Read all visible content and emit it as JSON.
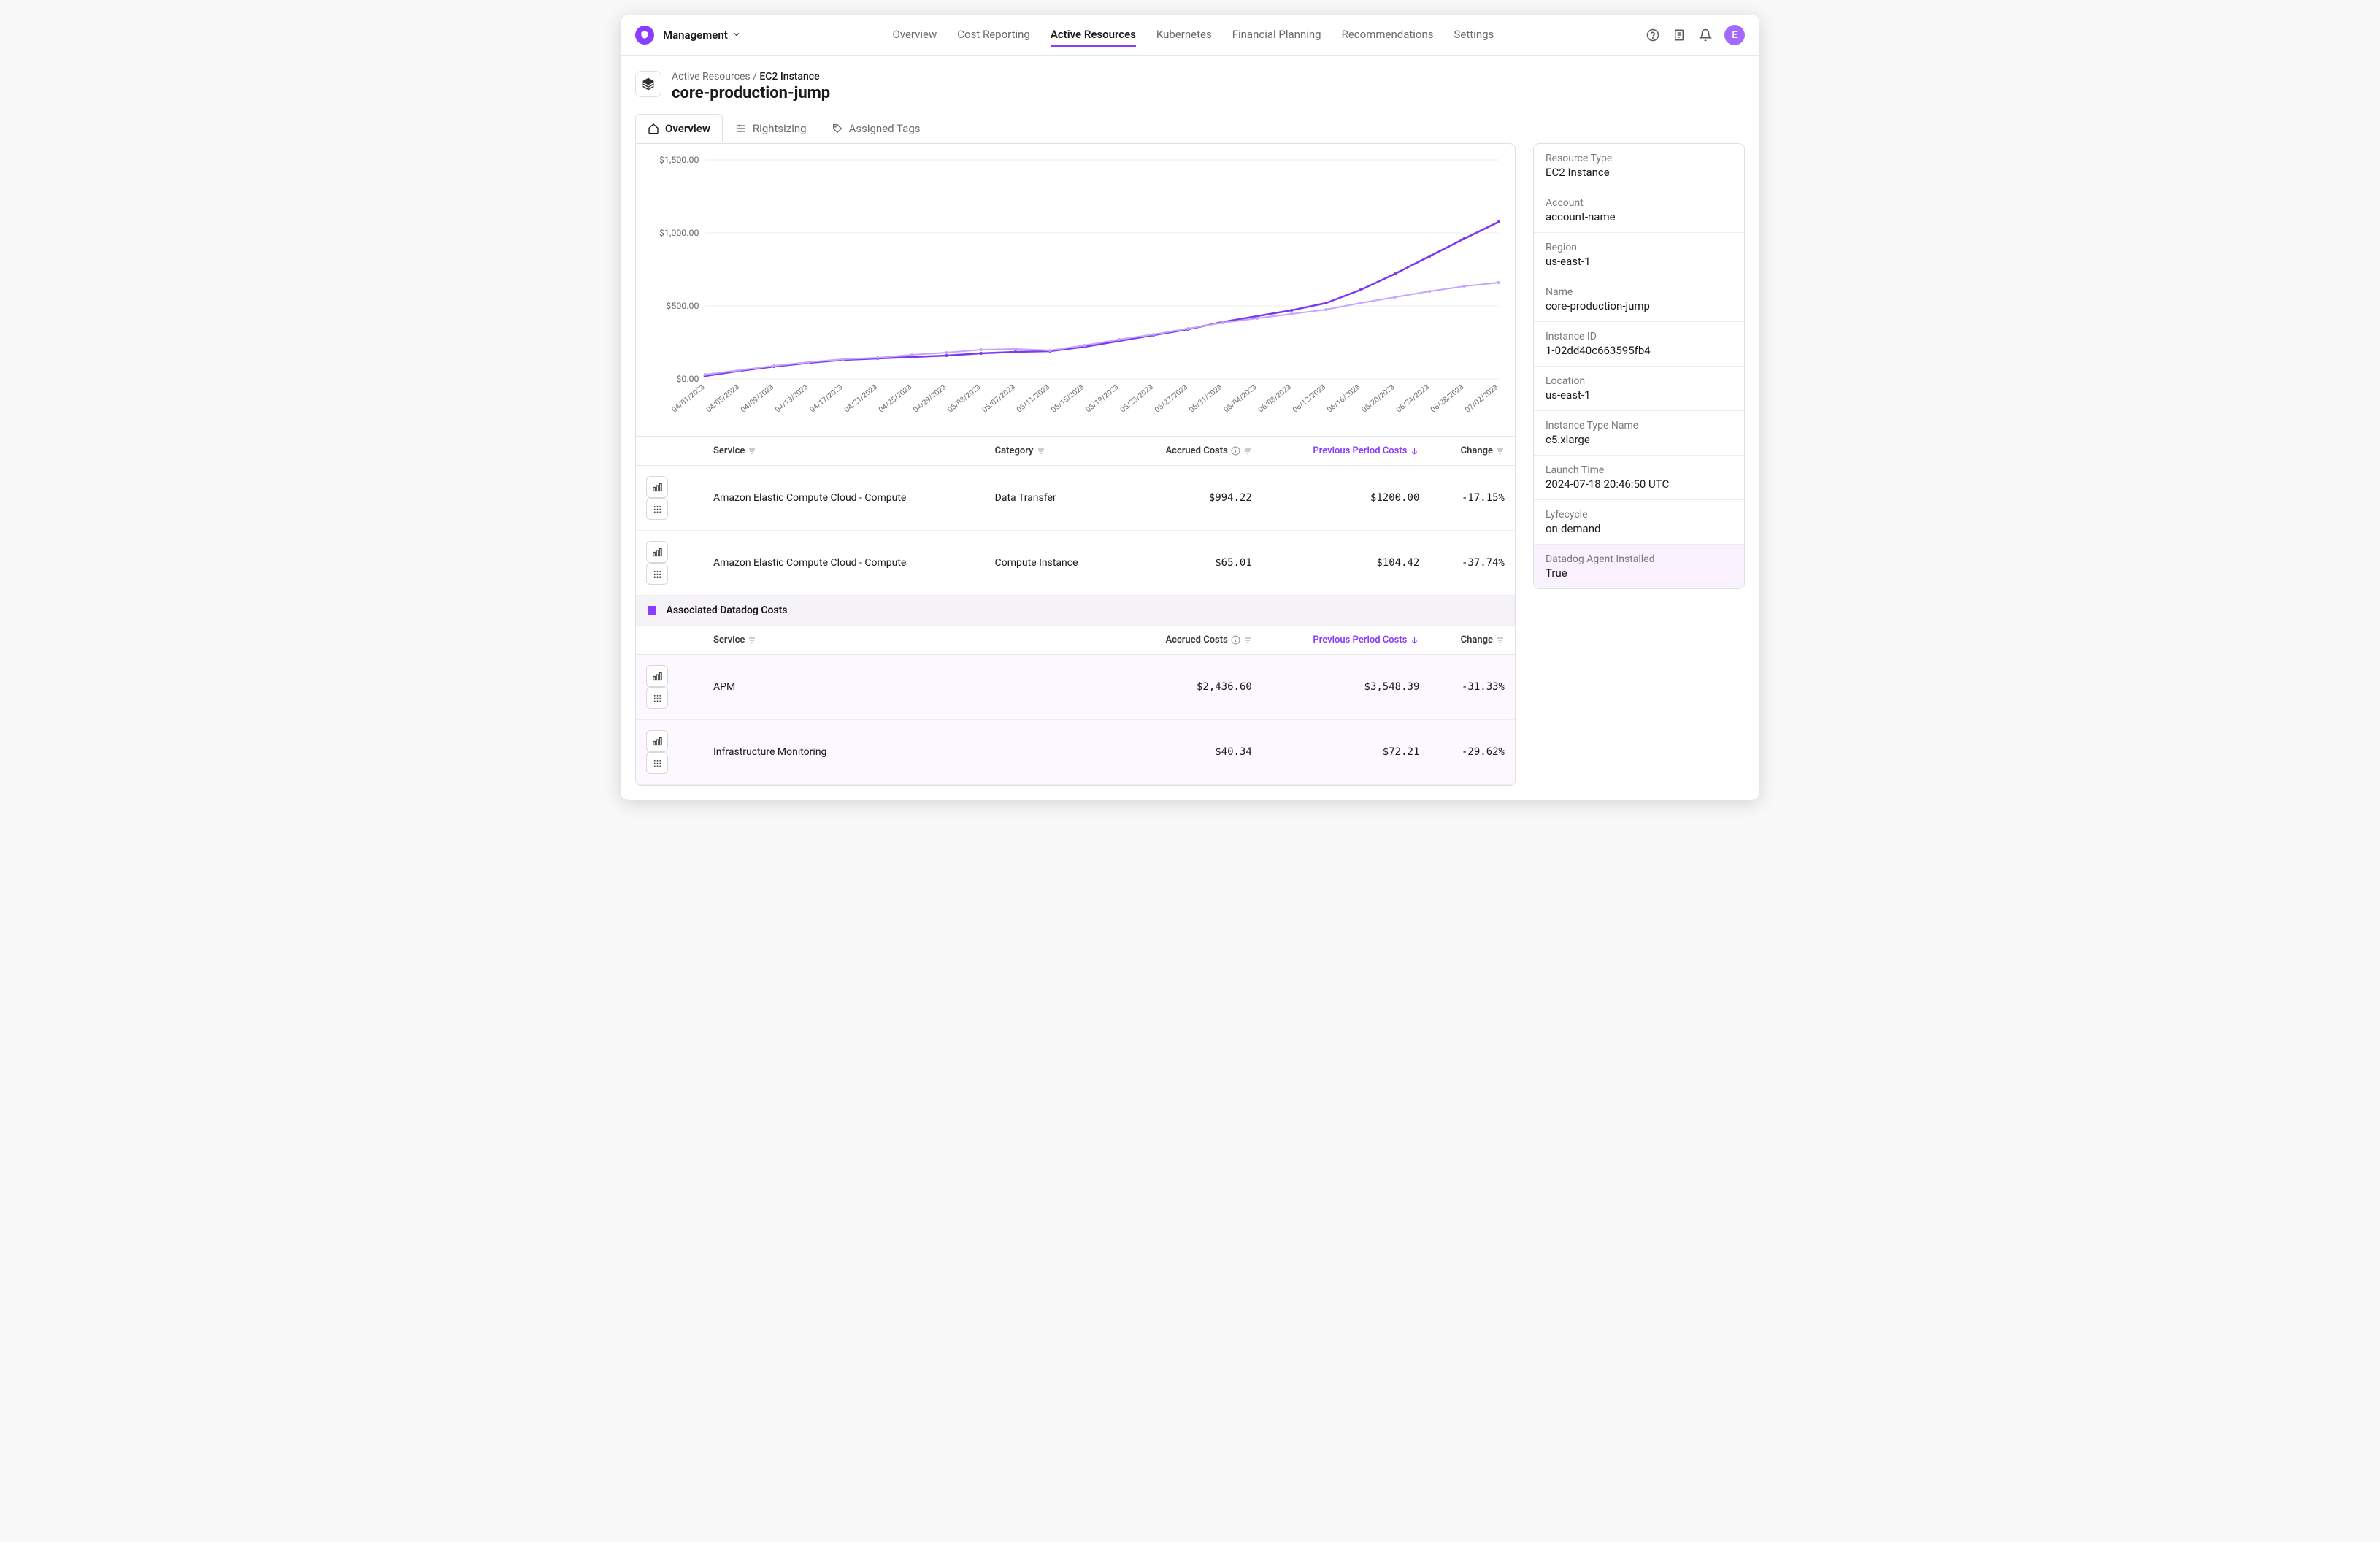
{
  "workspace": "Management",
  "avatar_initial": "E",
  "nav": [
    {
      "label": "Overview",
      "active": false
    },
    {
      "label": "Cost Reporting",
      "active": false
    },
    {
      "label": "Active Resources",
      "active": true
    },
    {
      "label": "Kubernetes",
      "active": false
    },
    {
      "label": "Financial Planning",
      "active": false
    },
    {
      "label": "Recommendations",
      "active": false
    },
    {
      "label": "Settings",
      "active": false
    }
  ],
  "breadcrumb": {
    "parent": "Active Resources",
    "type": "EC2 Instance"
  },
  "title": "core-production-jump",
  "tabs": [
    {
      "label": "Overview",
      "active": true
    },
    {
      "label": "Rightsizing",
      "active": false
    },
    {
      "label": "Assigned Tags",
      "active": false
    }
  ],
  "chart_data": {
    "type": "line",
    "xlabel": "",
    "ylabel": "",
    "ylim": [
      0,
      1500
    ],
    "yticks": [
      "$0.00",
      "$500.00",
      "$1,000.00",
      "$1,500.00"
    ],
    "categories": [
      "04/01/2023",
      "04/05/2023",
      "04/09/2023",
      "04/13/2023",
      "04/17/2023",
      "04/21/2023",
      "04/25/2023",
      "04/29/2023",
      "05/03/2023",
      "05/07/2023",
      "05/11/2023",
      "05/15/2023",
      "05/19/2023",
      "05/23/2023",
      "05/27/2023",
      "05/31/2023",
      "06/04/2023",
      "06/08/2023",
      "06/12/2023",
      "06/16/2023",
      "06/20/2023",
      "06/24/2023",
      "06/28/2023",
      "07/02/2023"
    ],
    "series": [
      {
        "name": "current",
        "color": "#7c3aed",
        "values": [
          20,
          55,
          85,
          110,
          130,
          140,
          150,
          160,
          175,
          185,
          190,
          220,
          260,
          300,
          340,
          390,
          430,
          470,
          520,
          610,
          720,
          840,
          960,
          1075
        ]
      },
      {
        "name": "previous",
        "color": "#c4a6ff",
        "values": [
          30,
          60,
          90,
          115,
          135,
          145,
          165,
          180,
          200,
          205,
          195,
          230,
          270,
          305,
          345,
          385,
          415,
          445,
          475,
          520,
          560,
          600,
          635,
          660
        ]
      }
    ]
  },
  "table": {
    "columns": {
      "service": "Service",
      "category": "Category",
      "accrued": "Accrued Costs",
      "previous": "Previous Period Costs",
      "change": "Change"
    },
    "rows": [
      {
        "service": "Amazon Elastic Compute Cloud - Compute",
        "category": "Data Transfer",
        "accrued": "$994.22",
        "previous": "$1200.00",
        "change": "-17.15%"
      },
      {
        "service": "Amazon Elastic Compute Cloud - Compute",
        "category": "Compute Instance",
        "accrued": "$65.01",
        "previous": "$104.42",
        "change": "-37.74%"
      }
    ],
    "datadog_section": "Associated Datadog Costs",
    "datadog_rows": [
      {
        "service": "APM",
        "accrued": "$2,436.60",
        "previous": "$3,548.39",
        "change": "-31.33%"
      },
      {
        "service": "Infrastructure Monitoring",
        "accrued": "$40.34",
        "previous": "$72.21",
        "change": "-29.62%"
      }
    ]
  },
  "meta": [
    {
      "label": "Resource Type",
      "value": "EC2 Instance"
    },
    {
      "label": "Account",
      "value": "account-name"
    },
    {
      "label": "Region",
      "value": "us-east-1"
    },
    {
      "label": "Name",
      "value": "core-production-jump"
    },
    {
      "label": "Instance ID",
      "value": "1-02dd40c663595fb4"
    },
    {
      "label": "Location",
      "value": "us-east-1"
    },
    {
      "label": "Instance Type Name",
      "value": "c5.xlarge"
    },
    {
      "label": "Launch Time",
      "value": "2024-07-18 20:46:50 UTC"
    },
    {
      "label": "Lyfecycle",
      "value": "on-demand"
    },
    {
      "label": "Datadog Agent Installed",
      "value": "True",
      "hl": true
    }
  ]
}
